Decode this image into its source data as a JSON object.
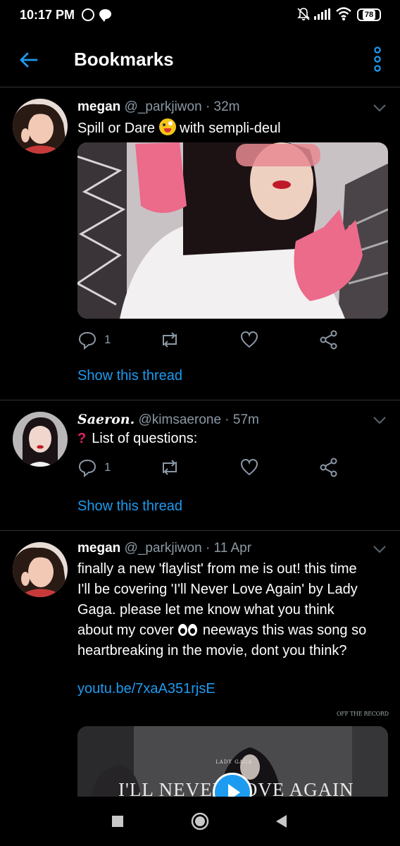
{
  "status_bar": {
    "time": "10:17 PM",
    "battery": "78",
    "icons": [
      "whatsapp-icon",
      "chat-icon",
      "mute-bell-icon",
      "signal-icon",
      "wifi-icon",
      "battery-icon"
    ]
  },
  "header": {
    "title": "Bookmarks",
    "back_icon": "arrow-left-icon",
    "more_icon": "more-vertical-icon",
    "accent": "#1d9bf0"
  },
  "tweets": [
    {
      "name": "megan",
      "handle": "@_parkjiwon",
      "dot": "·",
      "ago": "32m",
      "text_before": "Spill or Dare",
      "text_after": "with sempli-deul",
      "reply_count": "1",
      "show_thread": "Show this thread"
    },
    {
      "name": "Saeron.",
      "handle": "@kimsaerone",
      "dot": "·",
      "ago": "57m",
      "text": "List of questions:",
      "qmark": "?",
      "reply_count": "1",
      "show_thread": "Show this thread"
    },
    {
      "name": "megan",
      "handle": "@_parkjiwon",
      "dot": "·",
      "ago": "11 Apr",
      "text_line1": "finally a new 'flaylist' from me is out! this time",
      "text_line2": "I'll be covering 'I'll Never Love Again' by Lady",
      "text_line3": "Gaga. please let me know what you think",
      "text_line4a": "about my cover",
      "text_line4b": "neeways this was song so",
      "text_line5": "heartbreaking in the movie, dont you think?",
      "link": "youtu.be/7xaA351rjsE",
      "watermark": "OFF THE RECORD",
      "video_small": "LADY GAGA",
      "video_title": "I'LL NEVER LOVE AGAIN"
    }
  ],
  "nav": {
    "icons": [
      "recent-apps-icon",
      "home-icon",
      "back-triangle-icon"
    ]
  }
}
